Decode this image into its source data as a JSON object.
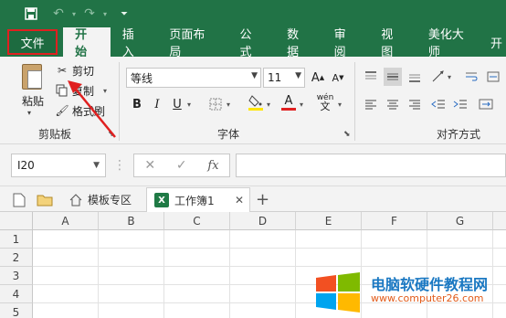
{
  "quick_access": {
    "save_icon": "save-icon",
    "undo_icon": "undo-icon",
    "redo_icon": "redo-icon",
    "customize_icon": "customize-icon"
  },
  "tabs": [
    {
      "label": "文件"
    },
    {
      "label": "开始"
    },
    {
      "label": "插入"
    },
    {
      "label": "页面布局"
    },
    {
      "label": "公式"
    },
    {
      "label": "数据"
    },
    {
      "label": "审阅"
    },
    {
      "label": "视图"
    },
    {
      "label": "美化大师"
    },
    {
      "label": "开"
    }
  ],
  "ribbon": {
    "clipboard": {
      "paste": "粘贴",
      "cut": "剪切",
      "copy": "复制",
      "format_painter": "格式刷",
      "group_label": "剪贴板"
    },
    "font": {
      "font_name": "等线",
      "font_size": "11",
      "grow": "A",
      "shrink": "A",
      "bold": "B",
      "italic": "I",
      "underline": "U",
      "font_color_letter": "A",
      "phonetic": "wén",
      "group_label": "字体"
    },
    "alignment": {
      "group_label": "对齐方式"
    }
  },
  "formula_bar": {
    "name_box": "I20",
    "cancel": "✕",
    "enter": "✓",
    "fx": "fx",
    "formula": ""
  },
  "doc_tabs": [
    {
      "label": "模板专区"
    },
    {
      "label": "工作簿1"
    }
  ],
  "add_tab": "+",
  "close_tab": "✕",
  "columns": [
    "A",
    "B",
    "C",
    "D",
    "E",
    "F",
    "G"
  ],
  "rows": [
    "1",
    "2",
    "3",
    "4",
    "5"
  ],
  "watermark": {
    "title": "电脑软硬件教程网",
    "url": "www.computer26.com"
  },
  "colors": {
    "brand": "#217346",
    "highlight_border": "#e02020",
    "arrow": "#e02020",
    "font_color": "#e02020",
    "fill_color": "#ffe600"
  }
}
